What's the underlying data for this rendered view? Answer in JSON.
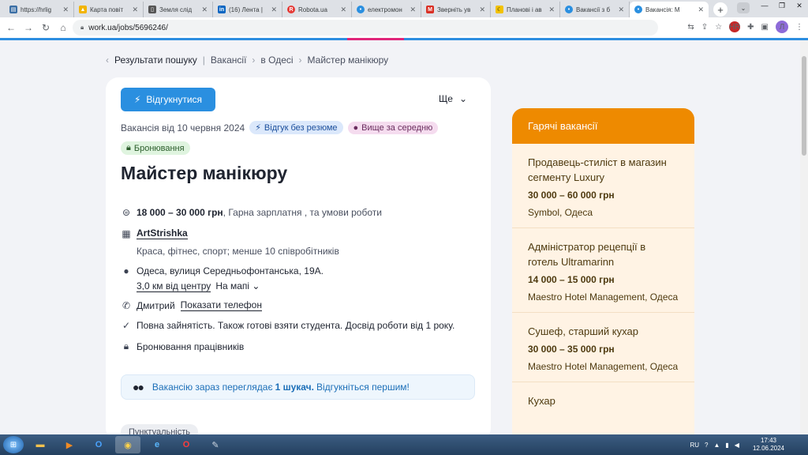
{
  "browser": {
    "tabs": [
      {
        "title": "https://hrlig",
        "icon": "doc-icon",
        "color": "#3a6ea5"
      },
      {
        "title": "Карта повіт",
        "icon": "alert-icon",
        "color": "#f2b400"
      },
      {
        "title": "Земля слід",
        "icon": "book-icon",
        "color": "#555555"
      },
      {
        "title": "(16) Лента |",
        "icon": "linkedin-icon",
        "color": "#0a66c2"
      },
      {
        "title": "Robota.ua",
        "icon": "robota-icon",
        "color": "#e53935"
      },
      {
        "title": "електромон",
        "icon": "workua-icon",
        "color": "#2a8fe0"
      },
      {
        "title": "Зверніть ув",
        "icon": "gmail-icon",
        "color": "#d93025"
      },
      {
        "title": "Планові і ав",
        "icon": "moon-icon",
        "color": "#222222"
      },
      {
        "title": "Вакансії з б",
        "icon": "workua-icon",
        "color": "#2a8fe0"
      },
      {
        "title": "Вакансія: М",
        "icon": "workua-icon",
        "color": "#2a8fe0",
        "active": true
      }
    ],
    "new_tab": "+",
    "url": "work.ua/jobs/5696246/",
    "profile_initial": "Л",
    "extension_badge": "HR"
  },
  "breadcrumb": [
    "Результати пошуку",
    "Вакансії",
    "в Одесі",
    "Майстер манікюру"
  ],
  "job": {
    "apply_label": "Відгукнутися",
    "more_label": "Ще",
    "date_text": "Вакансія від 10 червня 2024",
    "badges": [
      "Відгук без резюме",
      "Вище за середню",
      "Бронювання"
    ],
    "title": "Майстер манікюру",
    "salary": "18 000 – 30 000 грн",
    "salary_note": ", Гарна зарплатня , та умови роботи",
    "company": "ArtStrishka",
    "company_desc": "Краса, фітнес, спорт; менше 10 співробітників",
    "address": "Одеса, вулиця Середньофонтанська, 19A.",
    "distance": "3,0 км від центру",
    "map_label": "На мапі",
    "contact_name": "Дмитрий",
    "show_phone": "Показати телефон",
    "conditions": "Повна зайнятість. Також готові взяти студента. Досвід роботи від 1 року.",
    "reservation": "Бронювання працівників",
    "notice_pre": "Вакансію зараз переглядає",
    "notice_bold": "1 шукач.",
    "notice_post": "Відгукніться першим!",
    "tag": "Пунктуальність"
  },
  "hot": {
    "heading": "Гарячі вакансії",
    "items": [
      {
        "title": "Продавець-стиліст в магазин сегменту Luxury",
        "salary": "30 000 – 60 000 грн",
        "company": "Symbol, Одеса"
      },
      {
        "title": "Адміністратор рецепції в готель Ultramarinn",
        "salary": "14 000 – 15 000 грн",
        "company": "Maestro Hotel Management, Одеса"
      },
      {
        "title": "Сушеф, старший кухар",
        "salary": "30 000 – 35 000 грн",
        "company": "Maestro Hotel Management, Одеса"
      },
      {
        "title": "Кухар",
        "salary": "",
        "company": ""
      }
    ]
  },
  "taskbar": {
    "lang": "RU",
    "time": "17:43",
    "date": "12.06.2024"
  },
  "colors": {
    "accent": "#2a8fe0",
    "hot": "#ee8a00"
  }
}
